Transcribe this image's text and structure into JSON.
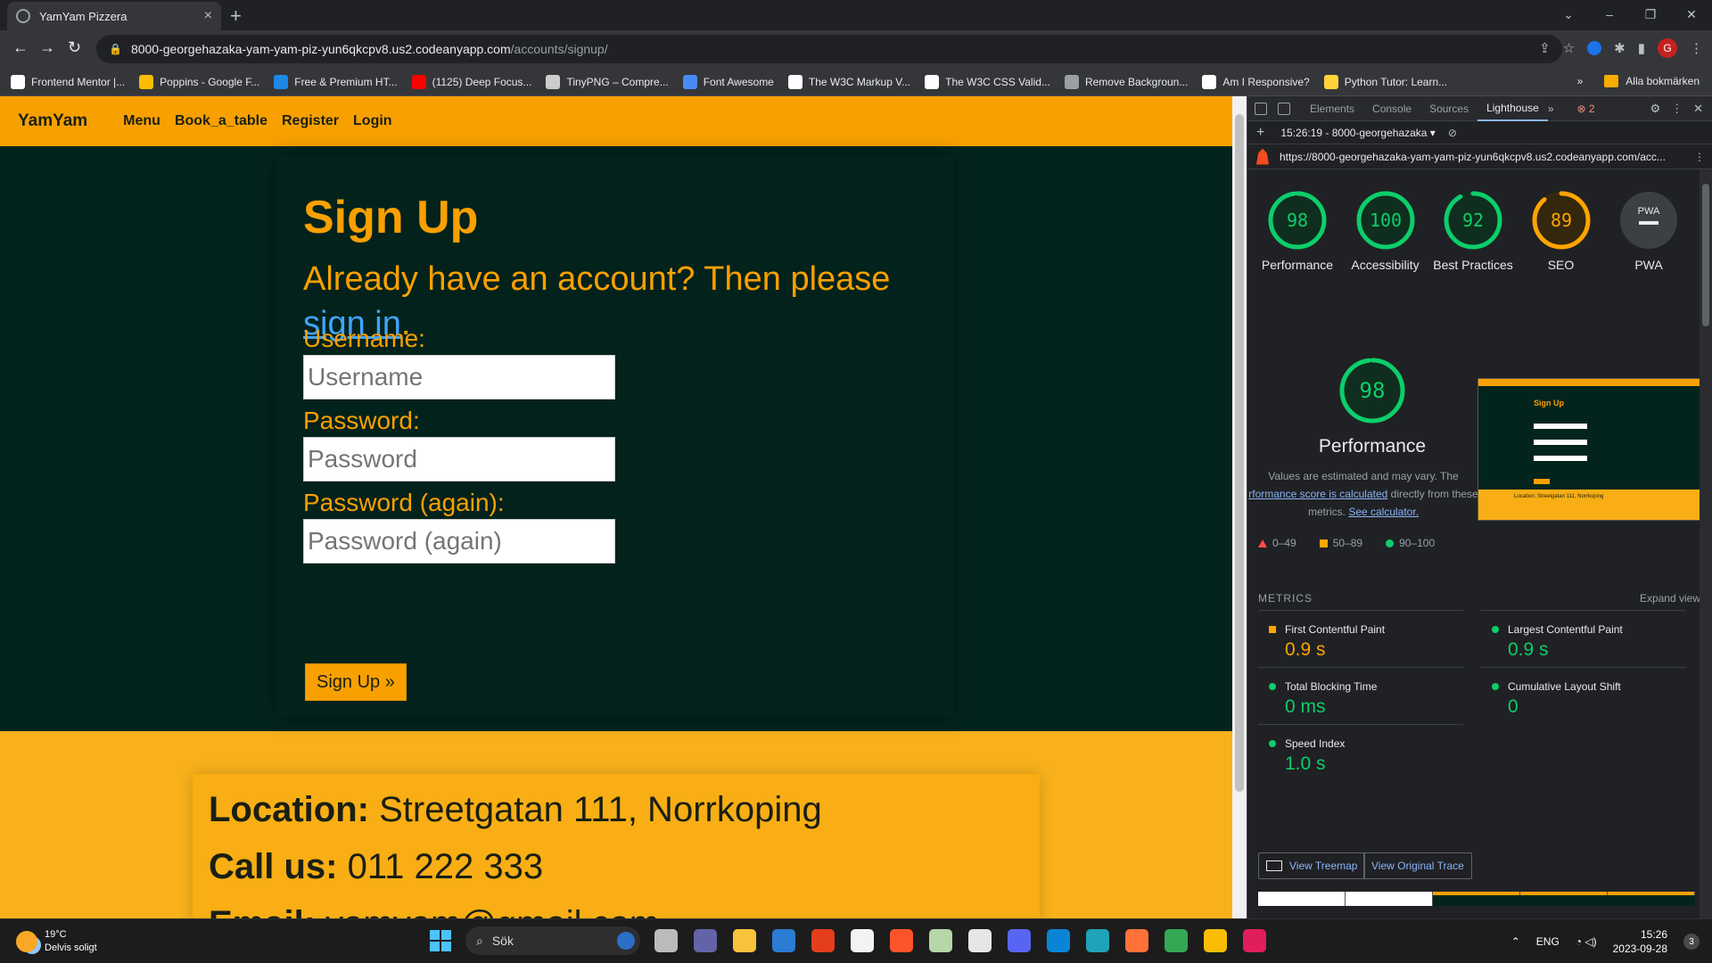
{
  "browser": {
    "tab_title": "YamYam Pizzera",
    "url_host": "8000-georgehazaka-yam-yam-piz-yun6qkcpv8.us2.codeanyapp.com",
    "url_path": "/accounts/signup/",
    "profile_initial": "G",
    "bookmarks": [
      {
        "label": "Frontend Mentor |...",
        "color": "#ffffff"
      },
      {
        "label": "Poppins - Google F...",
        "color": "#fbbc04"
      },
      {
        "label": "Free & Premium HT...",
        "color": "#1e88e5"
      },
      {
        "label": "(1125) Deep Focus...",
        "color": "#ff0000"
      },
      {
        "label": "TinyPNG – Compre...",
        "color": "#cccccc"
      },
      {
        "label": "Font Awesome",
        "color": "#4a8af4"
      },
      {
        "label": "The W3C Markup V...",
        "color": "#ffffff"
      },
      {
        "label": "The W3C CSS Valid...",
        "color": "#ffffff"
      },
      {
        "label": "Remove Backgroun...",
        "color": "#9aa0a6"
      },
      {
        "label": "Am I Responsive?",
        "color": "#ffffff"
      },
      {
        "label": "Python Tutor: Learn...",
        "color": "#ffd43b"
      }
    ],
    "all_bookmarks": "Alla bokmärken"
  },
  "site": {
    "brand": "YamYam",
    "nav": [
      "Menu",
      "Book_a_table",
      "Register",
      "Login"
    ],
    "heading": "Sign Up",
    "subtitle_pre": "Already have an account? Then please ",
    "subtitle_link": "sign in",
    "subtitle_post": ".",
    "username_label": "Username:",
    "username_placeholder": "Username",
    "password_label": "Password:",
    "password_placeholder": "Password",
    "password2_label": "Password (again):",
    "password2_placeholder": "Password (again)",
    "submit": "Sign Up »",
    "footer": {
      "location_label": "Location:",
      "location_value": " Streetgatan 111, Norrkoping",
      "call_label": "Call us:",
      "call_value": " 011 222 333",
      "email_label": "Email:",
      "email_value": " yamyam@gmail.com"
    }
  },
  "devtools": {
    "tabs": [
      "Elements",
      "Console",
      "Sources",
      "Lighthouse"
    ],
    "active_tab": "Lighthouse",
    "error_count": "2",
    "run_label": "15:26:19 - 8000-georgehazaka ▾",
    "report_url": "https://8000-georgehazaka-yam-yam-piz-yun6qkcpv8.us2.codeanyapp.com/acc...",
    "scores": [
      {
        "label": "Performance",
        "value": 98,
        "color": "#0cce6b"
      },
      {
        "label": "Accessibility",
        "value": 100,
        "color": "#0cce6b"
      },
      {
        "label": "Best Practices",
        "value": 92,
        "color": "#0cce6b"
      },
      {
        "label": "SEO",
        "value": 89,
        "color": "#ffa400"
      }
    ],
    "pwa_label": "PWA",
    "pwa_badge": "PWA",
    "perf_score": "98",
    "perf_title": "Performance",
    "perf_desc_1": "Values are estimated and may vary. The",
    "perf_desc_link": "rformance score is calculated",
    "perf_desc_2": " directly from these",
    "perf_desc_3": "metrics. ",
    "perf_desc_link2": "See calculator.",
    "legend": [
      "0–49",
      "50–89",
      "90–100"
    ],
    "metrics_title": "METRICS",
    "expand_view": "Expand view",
    "metrics": [
      {
        "name": "First Contentful Paint",
        "value": "0.9 s",
        "rating": "orange"
      },
      {
        "name": "Largest Contentful Paint",
        "value": "0.9 s",
        "rating": "green"
      },
      {
        "name": "Total Blocking Time",
        "value": "0 ms",
        "rating": "green"
      },
      {
        "name": "Cumulative Layout Shift",
        "value": "0",
        "rating": "green"
      },
      {
        "name": "Speed Index",
        "value": "1.0 s",
        "rating": "green"
      }
    ],
    "view_treemap": "View Treemap",
    "view_trace": "View Original Trace",
    "thumb_heading": "Sign Up",
    "thumb_footer": "Location: Streetgatan 111, Norrkoping"
  },
  "taskbar": {
    "temp": "19°C",
    "weather": "Delvis soligt",
    "search": "Sök",
    "lang": "ENG",
    "time": "15:26",
    "date": "2023-09-28",
    "notifications": "3",
    "apps": [
      {
        "name": "task-view",
        "color": "#bbbbbb"
      },
      {
        "name": "teams",
        "color": "#6264a7"
      },
      {
        "name": "file-explorer",
        "color": "#f8c33a"
      },
      {
        "name": "mail",
        "color": "#2b7cd3"
      },
      {
        "name": "office",
        "color": "#e43e1c"
      },
      {
        "name": "store",
        "color": "#f3f3f3"
      },
      {
        "name": "brave",
        "color": "#fb542b"
      },
      {
        "name": "app-green",
        "color": "#b5d6a7"
      },
      {
        "name": "snipping",
        "color": "#e6e6e6"
      },
      {
        "name": "discord",
        "color": "#5865f2"
      },
      {
        "name": "vscode",
        "color": "#0a84d6"
      },
      {
        "name": "edge",
        "color": "#1fa3b8"
      },
      {
        "name": "firefox",
        "color": "#ff7139"
      },
      {
        "name": "chrome",
        "color": "#34a853"
      },
      {
        "name": "chrome-active",
        "color": "#fbbc04"
      },
      {
        "name": "slack",
        "color": "#e01e5a"
      }
    ]
  }
}
